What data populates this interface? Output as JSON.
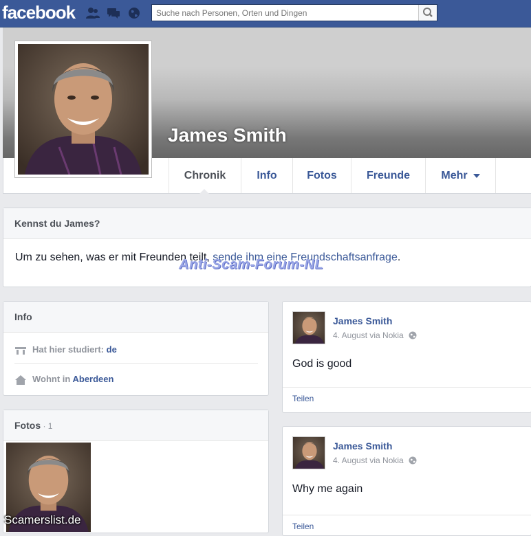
{
  "topbar": {
    "logo": "facebook",
    "search_placeholder": "Suche nach Personen, Orten und Dingen"
  },
  "profile": {
    "name": "James Smith"
  },
  "tabs": [
    {
      "label": "Chronik"
    },
    {
      "label": "Info"
    },
    {
      "label": "Fotos"
    },
    {
      "label": "Freunde"
    },
    {
      "label": "Mehr"
    }
  ],
  "kennst": {
    "title": "Kennst du James?",
    "text": "Um zu sehen, was er mit Freunden teilt, ",
    "link": "sende ihm eine Freundschaftsanfrage",
    "end": "."
  },
  "watermark": "Anti-Scam-Forum-NL",
  "info": {
    "title": "Info",
    "studied_label": "Hat hier studiert: ",
    "studied_value": "de",
    "lives_label": "Wohnt in ",
    "lives_value": "Aberdeen"
  },
  "fotos": {
    "title": "Fotos",
    "count": " · 1"
  },
  "posts": [
    {
      "author": "James Smith",
      "meta": "4. August via Nokia",
      "text": "God is good",
      "share": "Teilen"
    },
    {
      "author": "James Smith",
      "meta": "4. August via Nokia",
      "text": "Why me again",
      "share": "Teilen"
    }
  ],
  "footer_watermark": "Scamerslist.de",
  "colors": {
    "brand": "#3b5998",
    "background": "#e9eaed"
  }
}
